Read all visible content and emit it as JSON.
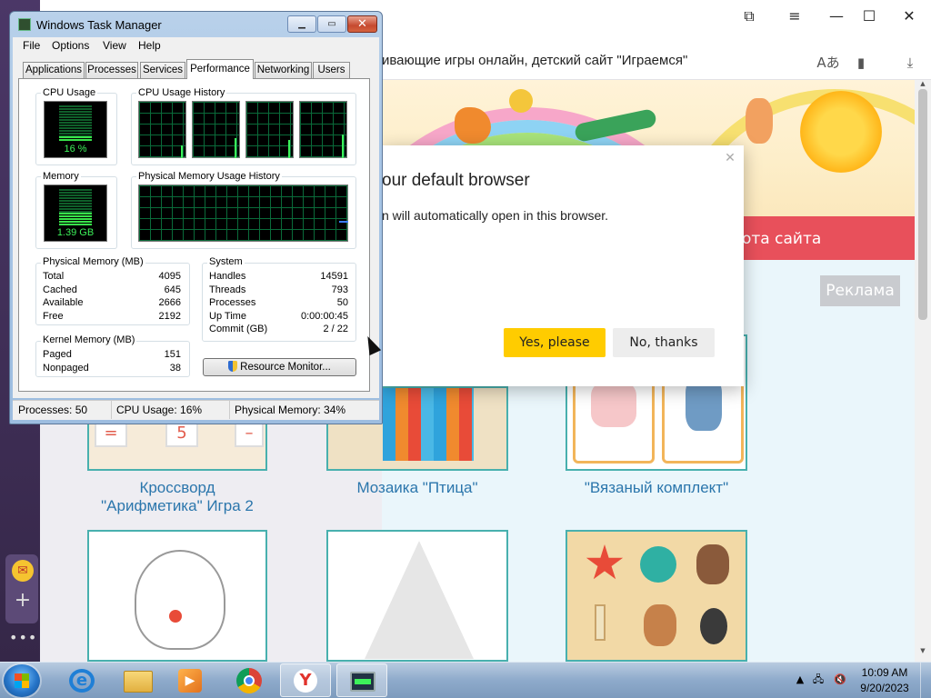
{
  "browser": {
    "address_text": "ивающие игры онлайн, детский сайт \"Играемся\"",
    "site_banner_text": "ота сайта",
    "ad_label": "Реклама",
    "cards": [
      {
        "caption": "Кроссворд \"Арифметика\" Игра 2"
      },
      {
        "caption": "Мозаика \"Птица\""
      },
      {
        "caption": "\"Вязаный комплект\""
      }
    ]
  },
  "dialog": {
    "title": "our default browser",
    "text": "n will automatically open in this browser.",
    "close_icon": "✕",
    "yes_label": "Yes, please",
    "no_label": "No, thanks"
  },
  "task_manager": {
    "title": "Windows Task Manager",
    "menu": [
      "File",
      "Options",
      "View",
      "Help"
    ],
    "tabs": [
      "Applications",
      "Processes",
      "Services",
      "Performance",
      "Networking",
      "Users"
    ],
    "active_tab": "Performance",
    "cpu_usage_label": "CPU Usage",
    "cpu_usage_value": "16 %",
    "cpu_usage_percent": 16,
    "cpu_history_label": "CPU Usage History",
    "memory_label": "Memory",
    "memory_value": "1.39 GB",
    "memory_percent": 34,
    "mem_history_label": "Physical Memory Usage History",
    "physical_memory": {
      "label": "Physical Memory (MB)",
      "rows": [
        {
          "name": "Total",
          "value": "4095"
        },
        {
          "name": "Cached",
          "value": "645"
        },
        {
          "name": "Available",
          "value": "2666"
        },
        {
          "name": "Free",
          "value": "2192"
        }
      ]
    },
    "kernel_memory": {
      "label": "Kernel Memory (MB)",
      "rows": [
        {
          "name": "Paged",
          "value": "151"
        },
        {
          "name": "Nonpaged",
          "value": "38"
        }
      ]
    },
    "system": {
      "label": "System",
      "rows": [
        {
          "name": "Handles",
          "value": "14591"
        },
        {
          "name": "Threads",
          "value": "793"
        },
        {
          "name": "Processes",
          "value": "50"
        },
        {
          "name": "Up Time",
          "value": "0:00:00:45"
        },
        {
          "name": "Commit (GB)",
          "value": "2 / 22"
        }
      ]
    },
    "resource_monitor_label": "Resource Monitor...",
    "status": {
      "processes": "Processes: 50",
      "cpu": "CPU Usage: 16%",
      "memory": "Physical Memory: 34%"
    }
  },
  "taskbar": {
    "time": "10:09 AM",
    "date": "9/20/2023",
    "apps": [
      "internet-explorer-icon",
      "file-explorer-icon",
      "media-player-icon",
      "chrome-icon",
      "yandex-browser-icon",
      "task-manager-icon"
    ]
  },
  "colors": {
    "accent_yellow": "#ffcc00",
    "graph_green": "#3df25a",
    "card_border": "#48b0ae",
    "caption_blue": "#2b76ac",
    "banner_red": "#e8505b"
  }
}
